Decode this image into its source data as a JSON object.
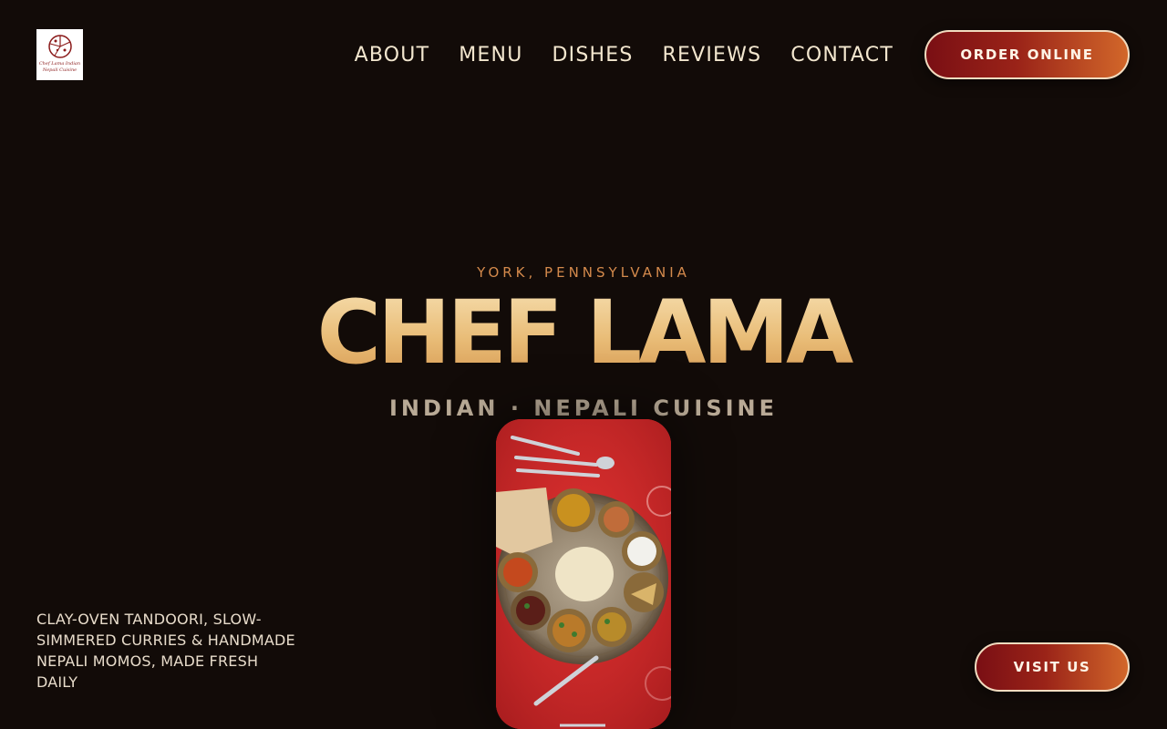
{
  "brand": {
    "logo_text": "Chef Lama Indian\nNepali Cuisine",
    "logo_icon": "pizza-icon"
  },
  "nav": {
    "items": [
      "ABOUT",
      "MENU",
      "DISHES",
      "REVIEWS",
      "CONTACT"
    ]
  },
  "header": {
    "order_label": "ORDER ONLINE"
  },
  "hero": {
    "eyebrow": "YORK, PENNSYLVANIA",
    "title": "CHEF LAMA",
    "subtitle": "INDIAN · NEPALI CUISINE",
    "tagline": "CLAY-OVEN TANDOORI, SLOW-SIMMERED CURRIES & HANDMADE NEPALI MOMOS, MADE FRESH DAILY",
    "visit_label": "VISIT US",
    "image_subject": "thali-plate-photo"
  },
  "colors": {
    "background": "#120b08",
    "accent_gold": "#e9bd78",
    "accent_orange": "#d48a4c",
    "button_start": "#7a0f14",
    "button_end": "#d2672a"
  }
}
